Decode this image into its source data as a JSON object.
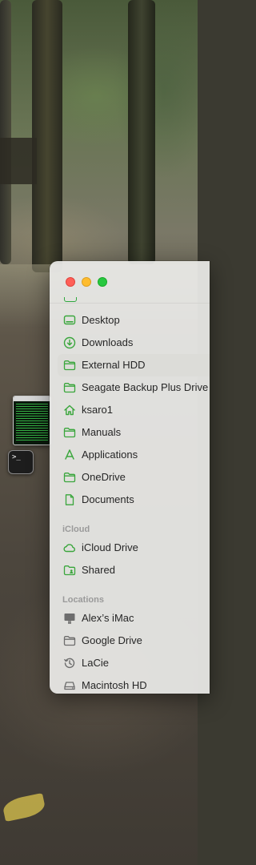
{
  "desktop": {
    "terminal_glyph": ">_"
  },
  "sidebar": {
    "favorites": [
      {
        "label": "Desktop",
        "icon": "desktop-icon"
      },
      {
        "label": "Downloads",
        "icon": "download-icon"
      },
      {
        "label": "External HDD",
        "icon": "folder-icon",
        "selected": true
      },
      {
        "label": "Seagate Backup Plus Drive",
        "icon": "folder-icon"
      },
      {
        "label": "ksaro1",
        "icon": "home-icon"
      },
      {
        "label": "Manuals",
        "icon": "folder-icon"
      },
      {
        "label": "Applications",
        "icon": "applications-icon"
      },
      {
        "label": "OneDrive",
        "icon": "folder-icon"
      },
      {
        "label": "Documents",
        "icon": "document-icon"
      }
    ],
    "icloud_header": "iCloud",
    "icloud": [
      {
        "label": "iCloud Drive",
        "icon": "cloud-icon"
      },
      {
        "label": "Shared",
        "icon": "shared-folder-icon"
      }
    ],
    "locations_header": "Locations",
    "locations": [
      {
        "label": "Alex’s iMac",
        "icon": "imac-icon"
      },
      {
        "label": "Google Drive",
        "icon": "folder-icon"
      },
      {
        "label": "LaCie",
        "icon": "time-machine-icon"
      },
      {
        "label": "Macintosh HD",
        "icon": "hard-drive-icon"
      }
    ]
  },
  "colors": {
    "accent_green": "#3aa63c",
    "close": "#ff5f57",
    "minimize": "#febc2e",
    "zoom": "#28c840"
  }
}
